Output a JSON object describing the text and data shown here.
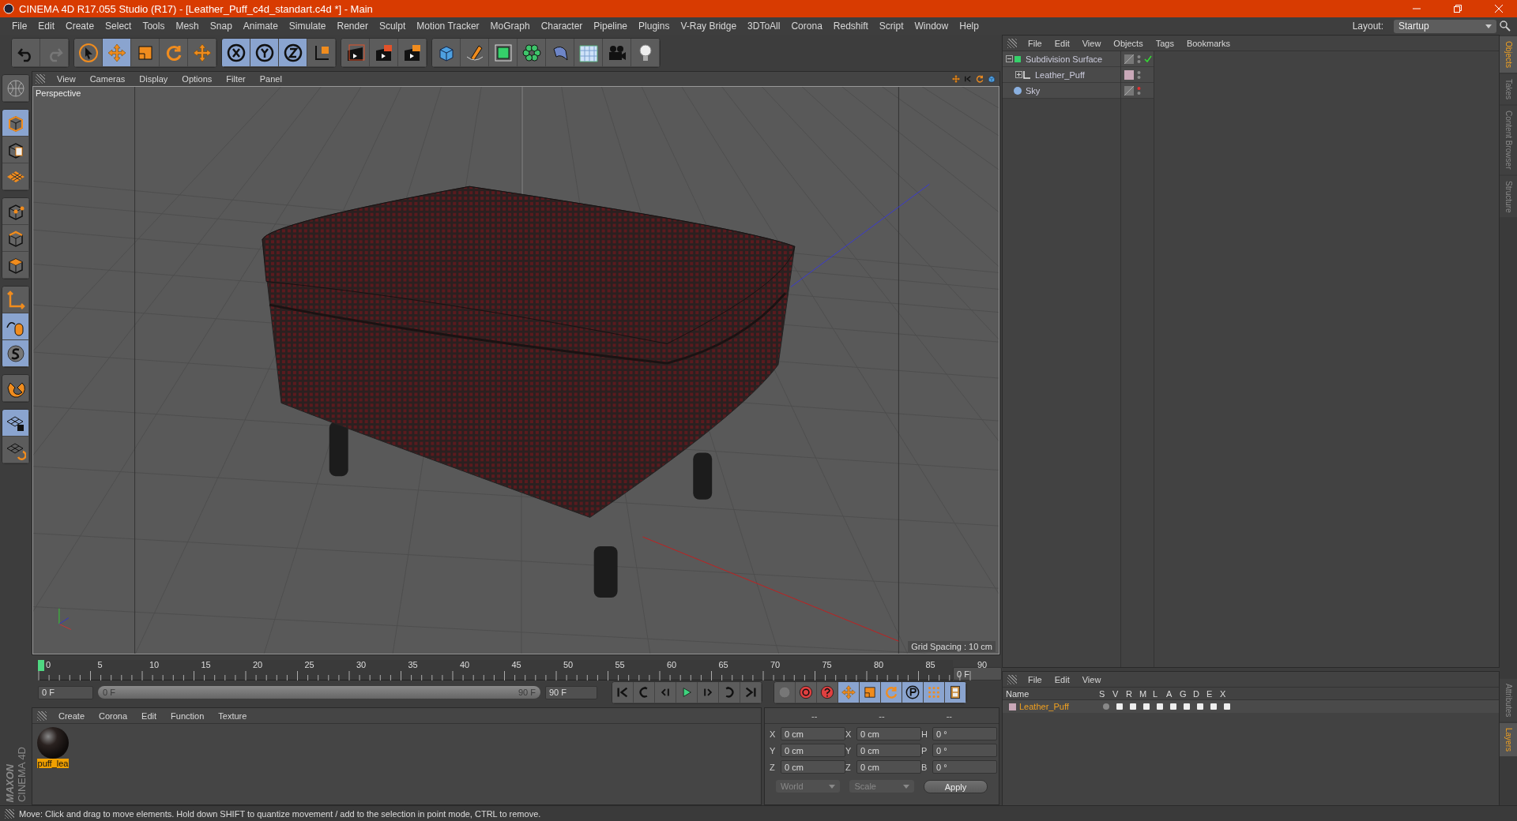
{
  "window": {
    "title": "CINEMA 4D R17.055 Studio (R17) - [Leather_Puff_c4d_standart.c4d *] - Main"
  },
  "menu": [
    "File",
    "Edit",
    "Create",
    "Select",
    "Tools",
    "Mesh",
    "Snap",
    "Animate",
    "Simulate",
    "Render",
    "Sculpt",
    "Motion Tracker",
    "MoGraph",
    "Character",
    "Pipeline",
    "Plugins",
    "V-Ray Bridge",
    "3DToAll",
    "Corona",
    "Redshift",
    "Script",
    "Window",
    "Help"
  ],
  "layout": {
    "label": "Layout:",
    "value": "Startup"
  },
  "toolbar_groups": [
    {
      "tools": [
        {
          "kind": "undo",
          "selected": false
        },
        {
          "kind": "redo",
          "selected": false
        }
      ]
    },
    {
      "tools": [
        {
          "kind": "select",
          "selected": false
        },
        {
          "kind": "move",
          "selected": true
        },
        {
          "kind": "scale",
          "selected": false
        },
        {
          "kind": "rotate",
          "selected": false
        },
        {
          "kind": "transform",
          "selected": false
        }
      ]
    },
    {
      "tools": [
        {
          "kind": "x",
          "selected": true
        },
        {
          "kind": "y",
          "selected": true
        },
        {
          "kind": "z",
          "selected": true
        },
        {
          "kind": "coords",
          "selected": false
        }
      ]
    },
    {
      "tools": [
        {
          "kind": "render-view",
          "selected": false
        },
        {
          "kind": "render-picture",
          "selected": false
        },
        {
          "kind": "render-settings",
          "selected": false
        }
      ]
    },
    {
      "tools": [
        {
          "kind": "cube",
          "selected": false
        },
        {
          "kind": "pen",
          "selected": false
        },
        {
          "kind": "subdivision",
          "selected": false
        },
        {
          "kind": "cloner",
          "selected": false
        },
        {
          "kind": "deformer",
          "selected": false
        },
        {
          "kind": "floor",
          "selected": false
        },
        {
          "kind": "camera",
          "selected": false
        },
        {
          "kind": "light",
          "selected": false
        }
      ]
    }
  ],
  "left_tool_groups": [
    {
      "tools": [
        {
          "kind": "globe",
          "selected": false
        }
      ]
    },
    {
      "tools": [
        {
          "kind": "model",
          "selected": true
        },
        {
          "kind": "texture",
          "selected": false
        },
        {
          "kind": "workplane",
          "selected": false
        }
      ]
    },
    {
      "tools": [
        {
          "kind": "points",
          "selected": false
        },
        {
          "kind": "edges",
          "selected": false
        },
        {
          "kind": "polygons",
          "selected": false
        }
      ]
    },
    {
      "tools": [
        {
          "kind": "axis",
          "selected": false
        },
        {
          "kind": "tweak",
          "selected": true
        },
        {
          "kind": "snap",
          "selected": true
        }
      ]
    },
    {
      "tools": [
        {
          "kind": "magnet",
          "selected": false
        }
      ]
    },
    {
      "tools": [
        {
          "kind": "grid-lock",
          "selected": true
        },
        {
          "kind": "grid-rotate",
          "selected": false
        }
      ]
    }
  ],
  "viewport": {
    "menu": [
      "View",
      "Cameras",
      "Display",
      "Options",
      "Filter",
      "Panel"
    ],
    "camera": "Perspective",
    "grid_spacing": "Grid Spacing : 10 cm"
  },
  "objects_panel": {
    "menu": [
      "File",
      "Edit",
      "View",
      "Objects",
      "Tags",
      "Bookmarks"
    ],
    "tree": [
      {
        "name": "Subdivision Surface",
        "kind": "subdivision",
        "expanded": true,
        "enabled": true,
        "children": [
          {
            "name": "Leather_Puff",
            "kind": "null",
            "expanded": false,
            "enabled": false
          }
        ]
      },
      {
        "name": "Sky",
        "kind": "sky",
        "enabled": false
      }
    ]
  },
  "side_tabs_top": [
    {
      "label": "Objects",
      "selected": true
    },
    {
      "label": "Takes",
      "selected": false
    },
    {
      "label": "Content Browser",
      "selected": false
    },
    {
      "label": "Structure",
      "selected": false
    }
  ],
  "side_tabs_bottom": [
    {
      "label": "Attributes",
      "selected": false
    },
    {
      "label": "Layers",
      "selected": true
    }
  ],
  "timeline": {
    "ticks": [
      "0",
      "5",
      "10",
      "15",
      "20",
      "25",
      "30",
      "35",
      "40",
      "45",
      "50",
      "55",
      "60",
      "65",
      "70",
      "75",
      "80",
      "85",
      "90"
    ],
    "frame_field": "0 F",
    "start_field": "0 F",
    "range": {
      "start": "0 F",
      "end": "90 F",
      "level": 1
    },
    "end_field": "90 F",
    "transport": [
      {
        "kind": "first"
      },
      {
        "kind": "prev-key"
      },
      {
        "kind": "prev-frame"
      },
      {
        "kind": "play"
      },
      {
        "kind": "next-frame"
      },
      {
        "kind": "next-key"
      },
      {
        "kind": "last"
      }
    ],
    "keys": [
      {
        "kind": "keyframe",
        "selected": false
      },
      {
        "kind": "autokey",
        "selected": false
      },
      {
        "kind": "help",
        "selected": false
      },
      {
        "kind": "move",
        "selected": true
      },
      {
        "kind": "scale",
        "selected": true
      },
      {
        "kind": "rotate",
        "selected": true
      },
      {
        "kind": "param",
        "selected": true
      },
      {
        "kind": "points-grid",
        "selected": true
      },
      {
        "kind": "film",
        "selected": true
      }
    ]
  },
  "materials": {
    "menu": [
      "Create",
      "Corona",
      "Edit",
      "Function",
      "Texture"
    ],
    "items": [
      {
        "name": "puff_lea",
        "selected": true
      }
    ]
  },
  "logo": {
    "brand": "MAXON",
    "product": "CINEMA 4D"
  },
  "coordinates": {
    "headers": [
      "--",
      "--",
      "--"
    ],
    "rows": [
      {
        "axis": "X",
        "value": "0 cm",
        "size_axis": "X",
        "size": "0 cm",
        "rot_axis": "H",
        "rot": "0 °"
      },
      {
        "axis": "Y",
        "value": "0 cm",
        "size_axis": "Y",
        "size": "0 cm",
        "rot_axis": "P",
        "rot": "0 °"
      },
      {
        "axis": "Z",
        "value": "0 cm",
        "size_axis": "Z",
        "size": "0 cm",
        "rot_axis": "B",
        "rot": "0 °"
      }
    ],
    "dropdowns": [
      "World",
      "Scale"
    ],
    "apply": "Apply"
  },
  "layers": {
    "menu": [
      "File",
      "Edit",
      "View"
    ],
    "columns": [
      "Name",
      "S",
      "V",
      "R",
      "M",
      "L",
      "A",
      "G",
      "D",
      "E",
      "X"
    ],
    "rows": [
      {
        "name": "Leather_Puff",
        "color": "#c9a8b8"
      }
    ]
  },
  "status": "Move: Click and drag to move elements. Hold down SHIFT to quantize movement / add to the selection in point mode, CTRL to remove."
}
